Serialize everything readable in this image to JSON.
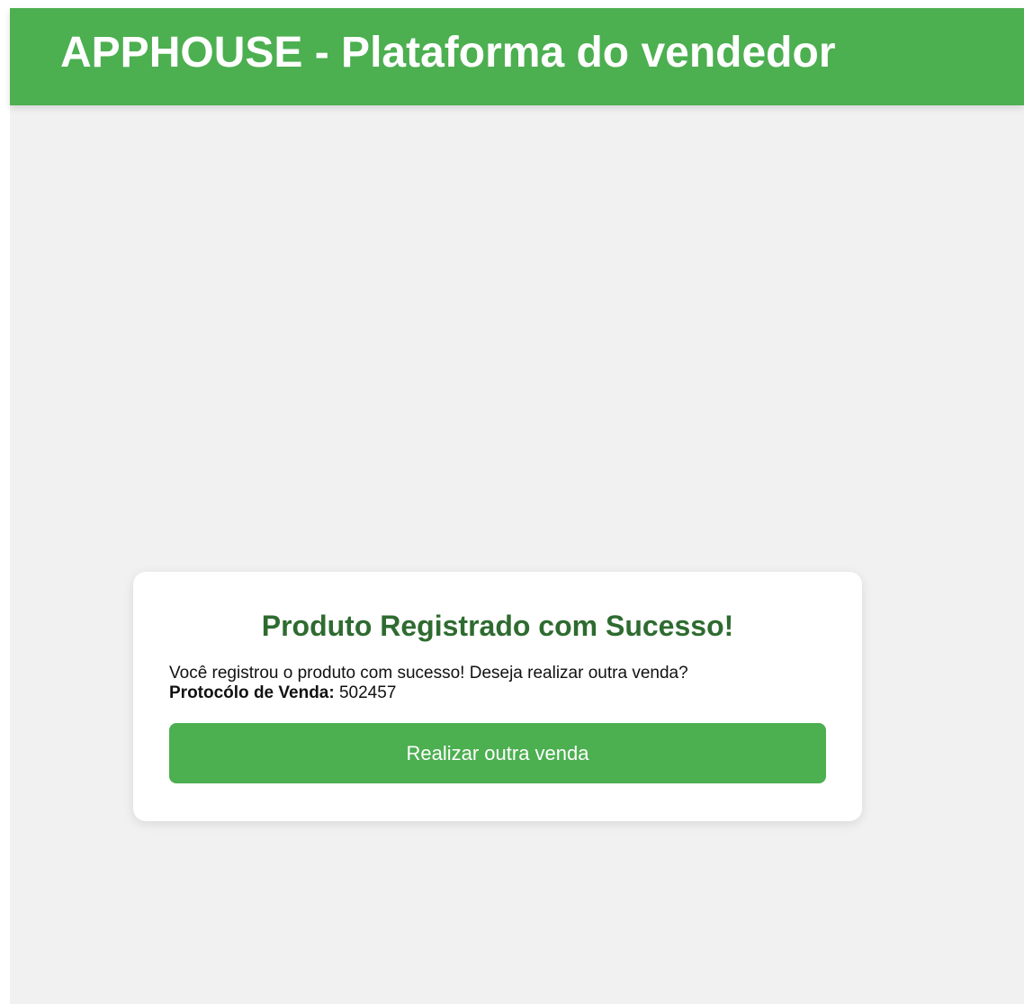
{
  "header": {
    "title": "APPHOUSE - Plataforma do vendedor"
  },
  "success_card": {
    "title": "Produto Registrado com Sucesso!",
    "message": "Você registrou o produto com sucesso! Deseja realizar outra venda?",
    "protocol_label": "Protocólo de Venda:",
    "protocol_value": "502457",
    "button_label": "Realizar outra venda"
  },
  "colors": {
    "brand_green": "#4caf50",
    "title_green": "#2e6b30",
    "page_background": "#f1f1f1",
    "card_background": "#ffffff"
  }
}
